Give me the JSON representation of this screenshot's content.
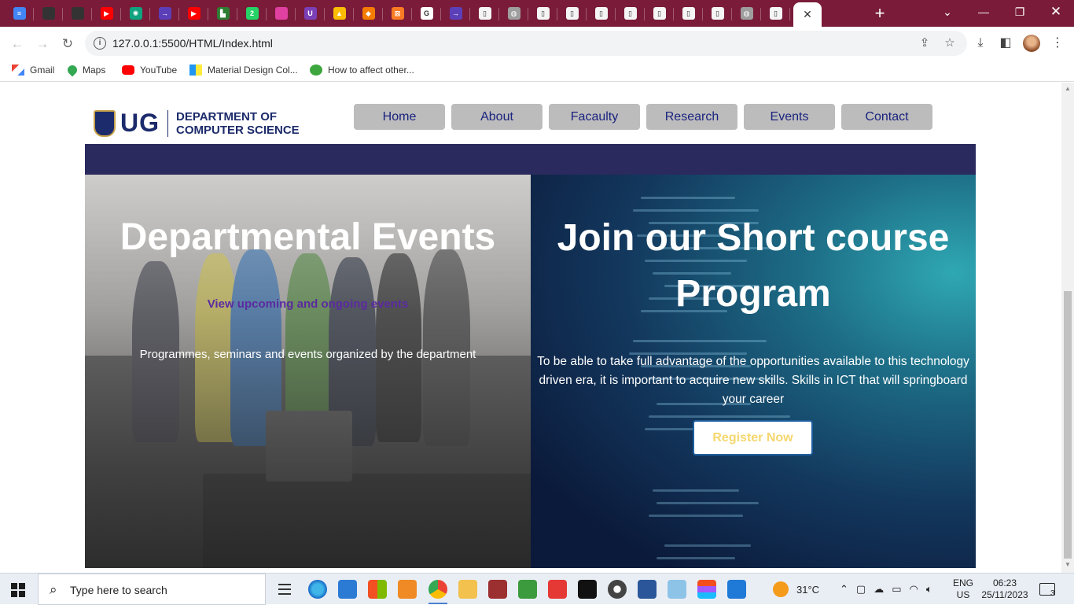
{
  "browser": {
    "url": "127.0.0.1:5500/HTML/Index.html",
    "tabs": [
      {
        "icon": "docs-icon",
        "color": "#4285f4",
        "glyph": "≡"
      },
      {
        "icon": "github-icon",
        "color": "#333333",
        "glyph": ""
      },
      {
        "icon": "github-icon",
        "color": "#333333",
        "glyph": ""
      },
      {
        "icon": "youtube-icon",
        "color": "#ff0000",
        "glyph": "▶"
      },
      {
        "icon": "chatgpt-icon",
        "color": "#10a37f",
        "glyph": "✺"
      },
      {
        "icon": "meet-icon",
        "color": "#5b3fb8",
        "glyph": "→"
      },
      {
        "icon": "youtube-icon",
        "color": "#ff0000",
        "glyph": "▶"
      },
      {
        "icon": "app-icon",
        "color": "#2e7d32",
        "glyph": "▙"
      },
      {
        "icon": "whatsapp-icon",
        "color": "#25d366",
        "glyph": "2"
      },
      {
        "icon": "ball-icon",
        "color": "#e040a0",
        "glyph": ""
      },
      {
        "icon": "shield-icon",
        "color": "#7b3fb8",
        "glyph": "U"
      },
      {
        "icon": "drive-icon",
        "color": "#fbbc04",
        "glyph": "▲"
      },
      {
        "icon": "diamond-icon",
        "color": "#f57c00",
        "glyph": "◆"
      },
      {
        "icon": "xampp-icon",
        "color": "#fb7a24",
        "glyph": "⊠"
      },
      {
        "icon": "google-icon",
        "color": "#ffffff",
        "glyph": "G"
      },
      {
        "icon": "meet-icon",
        "color": "#5b3fb8",
        "glyph": "→"
      },
      {
        "icon": "page-icon",
        "color": "#f5f5f5",
        "glyph": "▯"
      },
      {
        "icon": "globe-icon",
        "color": "#9e9e9e",
        "glyph": "◍"
      },
      {
        "icon": "page-icon",
        "color": "#f5f5f5",
        "glyph": "▯"
      },
      {
        "icon": "page-icon",
        "color": "#f5f5f5",
        "glyph": "▯"
      },
      {
        "icon": "page-icon",
        "color": "#f5f5f5",
        "glyph": "▯"
      },
      {
        "icon": "page-icon",
        "color": "#f5f5f5",
        "glyph": "▯"
      },
      {
        "icon": "page-icon",
        "color": "#f5f5f5",
        "glyph": "▯"
      },
      {
        "icon": "page-icon",
        "color": "#f5f5f5",
        "glyph": "▯"
      },
      {
        "icon": "page-icon",
        "color": "#f5f5f5",
        "glyph": "▯"
      },
      {
        "icon": "globe-icon",
        "color": "#9e9e9e",
        "glyph": "◍"
      },
      {
        "icon": "page-icon",
        "color": "#f5f5f5",
        "glyph": "▯"
      }
    ]
  },
  "bookmarks": [
    {
      "label": "Gmail",
      "icon": "gmail-icon"
    },
    {
      "label": "Maps",
      "icon": "maps-icon"
    },
    {
      "label": "YouTube",
      "icon": "youtube-icon"
    },
    {
      "label": "Material Design Col...",
      "icon": "material-icon"
    },
    {
      "label": "How to affect other...",
      "icon": "leaf-icon"
    }
  ],
  "site": {
    "logo_text": "UG",
    "dept_line1": "DEPARTMENT OF",
    "dept_line2": "COMPUTER SCIENCE",
    "nav": [
      "Home",
      "About",
      "Facaulty",
      "Research",
      "Events",
      "Contact"
    ],
    "events": {
      "title": "Departmental Events",
      "link": "View upcoming and ongoing events",
      "description": "Programmes, seminars and events organized by the department"
    },
    "course": {
      "title": "Join our Short course Program",
      "description": "To be able to take full advantage of the opportunities available to this technology driven era, it is important to acquire new skills. Skills in ICT that will springboard your career",
      "button": "Register Now"
    }
  },
  "taskbar": {
    "search_placeholder": "Type here to search",
    "weather": "31°C",
    "lang1": "ENG",
    "lang2": "US",
    "time": "06:23",
    "date": "25/11/2023",
    "notifications": "3"
  }
}
